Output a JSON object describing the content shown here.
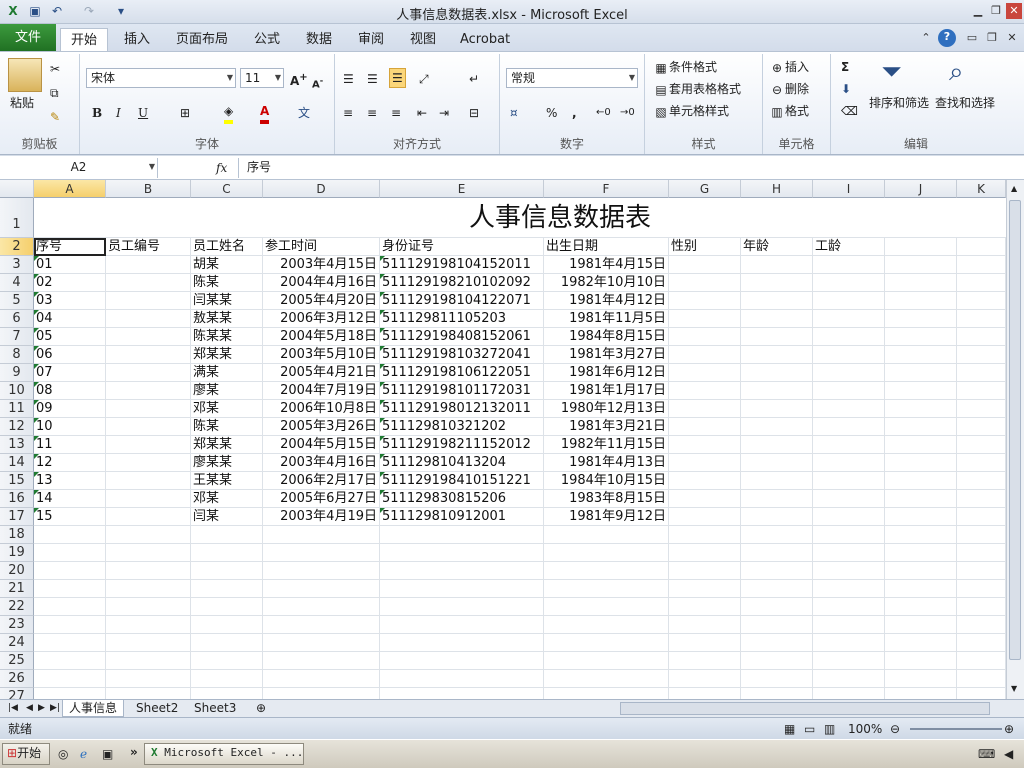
{
  "window": {
    "title": "人事信息数据表.xlsx - Microsoft Excel"
  },
  "tabs": [
    {
      "label": "文件"
    },
    {
      "label": "开始"
    },
    {
      "label": "插入"
    },
    {
      "label": "页面布局"
    },
    {
      "label": "公式"
    },
    {
      "label": "数据"
    },
    {
      "label": "审阅"
    },
    {
      "label": "视图"
    },
    {
      "label": "Acrobat"
    }
  ],
  "ribbon": {
    "clipboard": {
      "label": "剪贴板",
      "paste": "粘贴"
    },
    "font": {
      "label": "字体",
      "name": "宋体",
      "size": "11",
      "bold": "B",
      "italic": "I",
      "underline": "U"
    },
    "align": {
      "label": "对齐方式"
    },
    "number": {
      "label": "数字",
      "format": "常规",
      "percent": "%",
      "comma": ","
    },
    "styles": {
      "label": "样式",
      "cond": "条件格式",
      "table": "套用表格格式",
      "cellstyle": "单元格样式"
    },
    "cells": {
      "label": "单元格",
      "insert": "插入",
      "delete": "删除",
      "format": "格式"
    },
    "edit": {
      "label": "编辑",
      "sort": "排序和筛选",
      "find": "查找和选择"
    }
  },
  "formula_bar": {
    "name_box": "A2",
    "fx": "fx",
    "value": "序号"
  },
  "columns": [
    "A",
    "B",
    "C",
    "D",
    "E",
    "F",
    "G",
    "H",
    "I",
    "J",
    "K"
  ],
  "sheet": {
    "title": "人事信息数据表",
    "headers": [
      "序号",
      "员工编号",
      "员工姓名",
      "参工时间",
      "身份证号",
      "出生日期",
      "性别",
      "年龄",
      "工龄"
    ],
    "rows": [
      [
        "01",
        "",
        "胡某",
        "2003年4月15日",
        "511129198104152011",
        "1981年4月15日"
      ],
      [
        "02",
        "",
        "陈某",
        "2004年4月16日",
        "511129198210102092",
        "1982年10月10日"
      ],
      [
        "03",
        "",
        "闫某某",
        "2005年4月20日",
        "511129198104122071",
        "1981年4月12日"
      ],
      [
        "04",
        "",
        "敖某某",
        "2006年3月12日",
        "511129811105203",
        "1981年11月5日"
      ],
      [
        "05",
        "",
        "陈某某",
        "2004年5月18日",
        "511129198408152061",
        "1984年8月15日"
      ],
      [
        "06",
        "",
        "郑某某",
        "2003年5月10日",
        "511129198103272041",
        "1981年3月27日"
      ],
      [
        "07",
        "",
        "满某",
        "2005年4月21日",
        "511129198106122051",
        "1981年6月12日"
      ],
      [
        "08",
        "",
        "廖某",
        "2004年7月19日",
        "511129198101172031",
        "1981年1月17日"
      ],
      [
        "09",
        "",
        "邓某",
        "2006年10月8日",
        "511129198012132011",
        "1980年12月13日"
      ],
      [
        "10",
        "",
        "陈某",
        "2005年3月26日",
        "511129810321202",
        "1981年3月21日"
      ],
      [
        "11",
        "",
        "郑某某",
        "2004年5月15日",
        "511129198211152012",
        "1982年11月15日"
      ],
      [
        "12",
        "",
        "廖某某",
        "2003年4月16日",
        "511129810413204",
        "1981年4月13日"
      ],
      [
        "13",
        "",
        "王某某",
        "2006年2月17日",
        "511129198410151221",
        "1984年10月15日"
      ],
      [
        "14",
        "",
        "邓某",
        "2005年6月27日",
        "511129830815206",
        "1983年8月15日"
      ],
      [
        "15",
        "",
        "闫某",
        "2003年4月19日",
        "511129810912001",
        "1981年9月12日"
      ]
    ],
    "row_numbers": [
      "1",
      "2",
      "3",
      "4",
      "5",
      "6",
      "7",
      "8",
      "9",
      "10",
      "11",
      "12",
      "13",
      "14",
      "15",
      "16",
      "17",
      "18",
      "19",
      "20",
      "21",
      "22",
      "23",
      "24",
      "25",
      "26",
      "27"
    ]
  },
  "sheet_tabs": [
    "人事信息",
    "Sheet2",
    "Sheet3"
  ],
  "status": {
    "ready": "就绪",
    "zoom": "100%"
  },
  "taskbar": {
    "start": "开始",
    "app": "Microsoft Excel - ..."
  }
}
